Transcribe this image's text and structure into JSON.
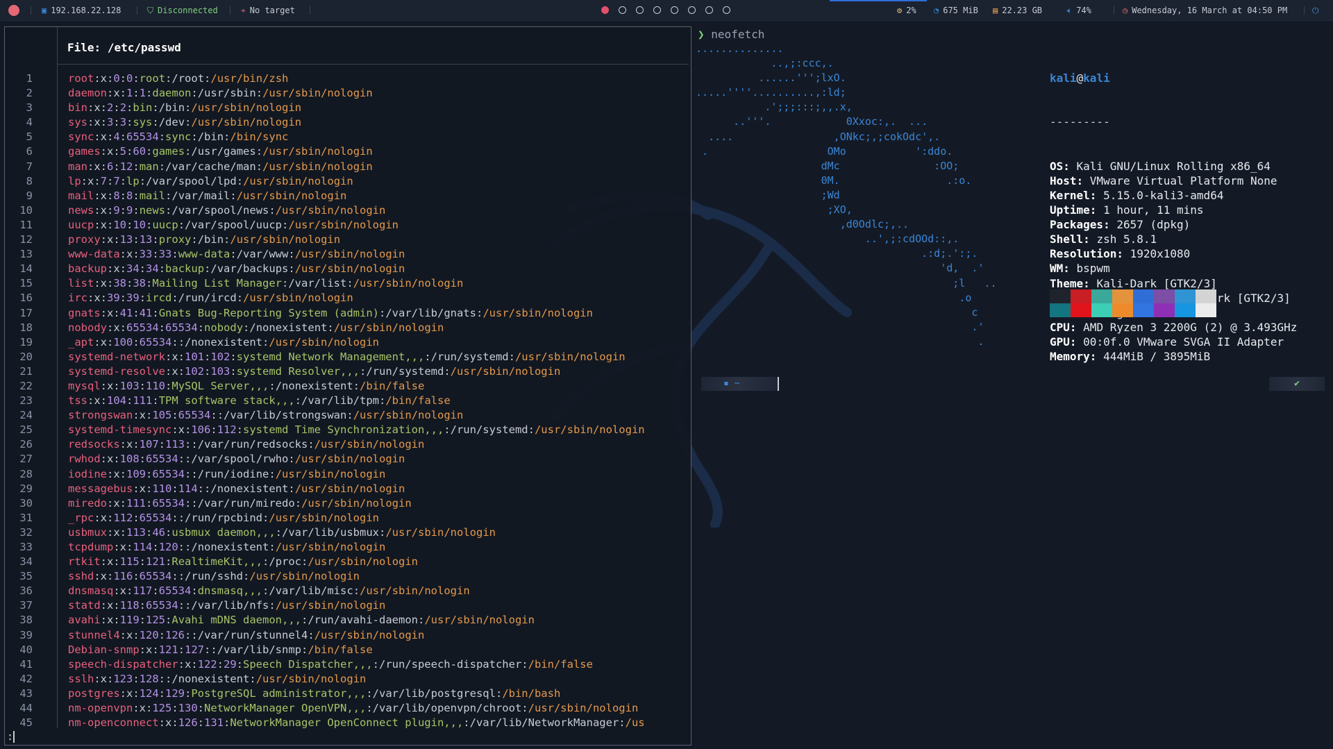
{
  "topbar": {
    "ip": "192.168.22.128",
    "vpn_status": "Disconnected",
    "target": "No target",
    "workspaces": [
      true,
      false,
      false,
      false,
      false,
      false,
      false,
      false
    ],
    "cpu": "2%",
    "memory": "675 MiB",
    "disk": "22.23 GB",
    "volume": "74%",
    "datetime": "Wednesday, 16 March at 04:50 PM",
    "colors": {
      "accent": "#2f6ed6",
      "active_ws": "#e2506b",
      "bg": "#1b2230"
    }
  },
  "left_pane": {
    "file_label": "File:",
    "file_path": "/etc/passwd",
    "pager_prompt": ":",
    "lines": [
      [
        "1",
        "root",
        "0",
        "0",
        "root",
        "/root",
        "/usr/bin/zsh"
      ],
      [
        "2",
        "daemon",
        "1",
        "1",
        "daemon",
        "/usr/sbin",
        "/usr/sbin/nologin"
      ],
      [
        "3",
        "bin",
        "2",
        "2",
        "bin",
        "/bin",
        "/usr/sbin/nologin"
      ],
      [
        "4",
        "sys",
        "3",
        "3",
        "sys",
        "/dev",
        "/usr/sbin/nologin"
      ],
      [
        "5",
        "sync",
        "4",
        "65534",
        "sync",
        "/bin",
        "/bin/sync"
      ],
      [
        "6",
        "games",
        "5",
        "60",
        "games",
        "/usr/games",
        "/usr/sbin/nologin"
      ],
      [
        "7",
        "man",
        "6",
        "12",
        "man",
        "/var/cache/man",
        "/usr/sbin/nologin"
      ],
      [
        "8",
        "lp",
        "7",
        "7",
        "lp",
        "/var/spool/lpd",
        "/usr/sbin/nologin"
      ],
      [
        "9",
        "mail",
        "8",
        "8",
        "mail",
        "/var/mail",
        "/usr/sbin/nologin"
      ],
      [
        "10",
        "news",
        "9",
        "9",
        "news",
        "/var/spool/news",
        "/usr/sbin/nologin"
      ],
      [
        "11",
        "uucp",
        "10",
        "10",
        "uucp",
        "/var/spool/uucp",
        "/usr/sbin/nologin"
      ],
      [
        "12",
        "proxy",
        "13",
        "13",
        "proxy",
        "/bin",
        "/usr/sbin/nologin"
      ],
      [
        "13",
        "www-data",
        "33",
        "33",
        "www-data",
        "/var/www",
        "/usr/sbin/nologin"
      ],
      [
        "14",
        "backup",
        "34",
        "34",
        "backup",
        "/var/backups",
        "/usr/sbin/nologin"
      ],
      [
        "15",
        "list",
        "38",
        "38",
        "Mailing List Manager",
        "/var/list",
        "/usr/sbin/nologin"
      ],
      [
        "16",
        "irc",
        "39",
        "39",
        "ircd",
        "/run/ircd",
        "/usr/sbin/nologin"
      ],
      [
        "17",
        "gnats",
        "41",
        "41",
        "Gnats Bug-Reporting System (admin)",
        "/var/lib/gnats",
        "/usr/sbin/nologin"
      ],
      [
        "18",
        "nobody",
        "65534",
        "65534",
        "nobody",
        "/nonexistent",
        "/usr/sbin/nologin"
      ],
      [
        "19",
        "_apt",
        "100",
        "65534",
        "",
        "/nonexistent",
        "/usr/sbin/nologin"
      ],
      [
        "20",
        "systemd-network",
        "101",
        "102",
        "systemd Network Management,,,",
        "/run/systemd",
        "/usr/sbin/nologin"
      ],
      [
        "21",
        "systemd-resolve",
        "102",
        "103",
        "systemd Resolver,,,",
        "/run/systemd",
        "/usr/sbin/nologin"
      ],
      [
        "22",
        "mysql",
        "103",
        "110",
        "MySQL Server,,,",
        "/nonexistent",
        "/bin/false"
      ],
      [
        "23",
        "tss",
        "104",
        "111",
        "TPM software stack,,,",
        "/var/lib/tpm",
        "/bin/false"
      ],
      [
        "24",
        "strongswan",
        "105",
        "65534",
        "",
        "/var/lib/strongswan",
        "/usr/sbin/nologin"
      ],
      [
        "25",
        "systemd-timesync",
        "106",
        "112",
        "systemd Time Synchronization,,,",
        "/run/systemd",
        "/usr/sbin/nologin"
      ],
      [
        "26",
        "redsocks",
        "107",
        "113",
        "",
        "/var/run/redsocks",
        "/usr/sbin/nologin"
      ],
      [
        "27",
        "rwhod",
        "108",
        "65534",
        "",
        "/var/spool/rwho",
        "/usr/sbin/nologin"
      ],
      [
        "28",
        "iodine",
        "109",
        "65534",
        "",
        "/run/iodine",
        "/usr/sbin/nologin"
      ],
      [
        "29",
        "messagebus",
        "110",
        "114",
        "",
        "/nonexistent",
        "/usr/sbin/nologin"
      ],
      [
        "30",
        "miredo",
        "111",
        "65534",
        "",
        "/var/run/miredo",
        "/usr/sbin/nologin"
      ],
      [
        "31",
        "_rpc",
        "112",
        "65534",
        "",
        "/run/rpcbind",
        "/usr/sbin/nologin"
      ],
      [
        "32",
        "usbmux",
        "113",
        "46",
        "usbmux daemon,,,",
        "/var/lib/usbmux",
        "/usr/sbin/nologin"
      ],
      [
        "33",
        "tcpdump",
        "114",
        "120",
        "",
        "/nonexistent",
        "/usr/sbin/nologin"
      ],
      [
        "34",
        "rtkit",
        "115",
        "121",
        "RealtimeKit,,,",
        "/proc",
        "/usr/sbin/nologin"
      ],
      [
        "35",
        "sshd",
        "116",
        "65534",
        "",
        "/run/sshd",
        "/usr/sbin/nologin"
      ],
      [
        "36",
        "dnsmasq",
        "117",
        "65534",
        "dnsmasq,,,",
        "/var/lib/misc",
        "/usr/sbin/nologin"
      ],
      [
        "37",
        "statd",
        "118",
        "65534",
        "",
        "/var/lib/nfs",
        "/usr/sbin/nologin"
      ],
      [
        "38",
        "avahi",
        "119",
        "125",
        "Avahi mDNS daemon,,,",
        "/run/avahi-daemon",
        "/usr/sbin/nologin"
      ],
      [
        "39",
        "stunnel4",
        "120",
        "126",
        "",
        "/var/run/stunnel4",
        "/usr/sbin/nologin"
      ],
      [
        "40",
        "Debian-snmp",
        "121",
        "127",
        "",
        "/var/lib/snmp",
        "/bin/false"
      ],
      [
        "41",
        "speech-dispatcher",
        "122",
        "29",
        "Speech Dispatcher,,,",
        "/run/speech-dispatcher",
        "/bin/false"
      ],
      [
        "42",
        "sslh",
        "123",
        "128",
        "",
        "/nonexistent",
        "/usr/sbin/nologin"
      ],
      [
        "43",
        "postgres",
        "124",
        "129",
        "PostgreSQL administrator,,,",
        "/var/lib/postgresql",
        "/bin/bash"
      ],
      [
        "44",
        "nm-openvpn",
        "125",
        "130",
        "NetworkManager OpenVPN,,,",
        "/var/lib/openvpn/chroot",
        "/usr/sbin/nologin"
      ],
      [
        "45",
        "nm-openconnect",
        "126",
        "131",
        "NetworkManager OpenConnect plugin,,,",
        "/var/lib/NetworkManager",
        "/us"
      ]
    ]
  },
  "right_pane": {
    "command": "neofetch",
    "ascii_art": "..............\n            ..,;:ccc,.\n          ......''';lxO.\n.....''''..........,:ld;\n           .';;;:::;,,.x,\n      ..'''.            0Xxoc:,.  ...\n  ....                ,ONkc;,;cokOdc',.\n .                   OMo           ':ddo.\n                    dMc               :OO;\n                    0M.                 .:o.\n                    ;Wd\n                     ;XO,\n                       ,d0Odlc;,..\n                           ..',;:cdOOd::,.\n                                    .:d;.':;.\n                                       'd,  .'\n                                         ;l   ..\n                                          .o\n                                            c\n                                            .'\n                                             .",
    "user": "kali",
    "at": "@",
    "host": "kali",
    "divider": "---------",
    "info": [
      {
        "key": "OS",
        "value": "Kali GNU/Linux Rolling x86_64"
      },
      {
        "key": "Host",
        "value": "VMware Virtual Platform None"
      },
      {
        "key": "Kernel",
        "value": "5.15.0-kali3-amd64"
      },
      {
        "key": "Uptime",
        "value": "1 hour, 11 mins"
      },
      {
        "key": "Packages",
        "value": "2657 (dpkg)"
      },
      {
        "key": "Shell",
        "value": "zsh 5.8.1"
      },
      {
        "key": "Resolution",
        "value": "1920x1080"
      },
      {
        "key": "WM",
        "value": "bspwm"
      },
      {
        "key": "Theme",
        "value": "Kali-Dark [GTK2/3]"
      },
      {
        "key": "Icons",
        "value": "Flat-Remix-Blue-Dark [GTK2/3]"
      },
      {
        "key": "Terminal",
        "value": "gnome-terminal"
      },
      {
        "key": "CPU",
        "value": "AMD Ryzen 3 2200G (2) @ 3.493GHz"
      },
      {
        "key": "GPU",
        "value": "00:0f.0 VMware SVGA II Adapter"
      },
      {
        "key": "Memory",
        "value": "444MiB / 3895MiB"
      }
    ],
    "swatch_colors_top": [
      "#1e232c",
      "#c81e24",
      "#3aa89a",
      "#e5923d",
      "#2f6ed6",
      "#7d4ea6",
      "#2f94d4",
      "#d4d4d4"
    ],
    "swatch_colors_bottom": [
      "#12757f",
      "#e1131b",
      "#3ccfb6",
      "#ee8a2a",
      "#3274e0",
      "#8f2fb5",
      "#1796e0",
      "#ececec"
    ],
    "prompt_left": "~",
    "prompt_right": "✔"
  }
}
